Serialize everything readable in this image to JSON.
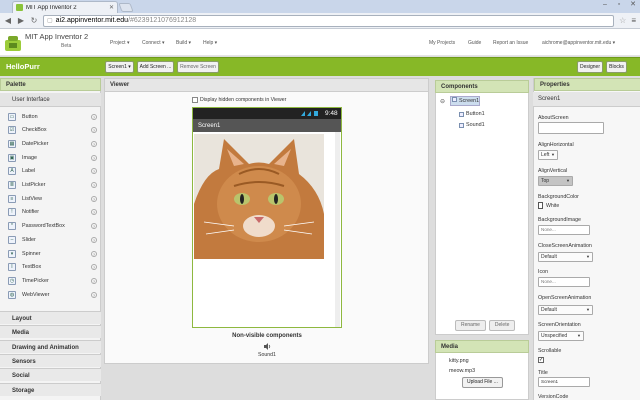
{
  "browser": {
    "tab_title": "MIT App Inventor 2",
    "url_host": "ai2.appinventor.mit.edu",
    "url_path": "/#6239121076912128",
    "colors": {
      "tabbar": "#c9d6ea"
    }
  },
  "header": {
    "brand": "MIT App Inventor 2",
    "beta": "Beta",
    "nav_left": [
      "Project ▾",
      "Connect ▾",
      "Build ▾",
      "Help ▾"
    ],
    "nav_right": [
      "My Projects",
      "Guide",
      "Report an Issue",
      "aichrome@appinventor.mit.edu ▾"
    ]
  },
  "projectbar": {
    "name": "HelloPurr",
    "screen_select": "Screen1 ▾",
    "add_screen": "Add Screen ...",
    "remove_screen": "Remove Screen",
    "designer": "Designer",
    "blocks": "Blocks",
    "accent": "#87b827"
  },
  "palette": {
    "title": "Palette",
    "section": "User Interface",
    "items": [
      {
        "label": "Button",
        "icon": "button-icon"
      },
      {
        "label": "CheckBox",
        "icon": "checkbox-icon"
      },
      {
        "label": "DatePicker",
        "icon": "datepicker-icon"
      },
      {
        "label": "Image",
        "icon": "image-icon"
      },
      {
        "label": "Label",
        "icon": "label-icon"
      },
      {
        "label": "ListPicker",
        "icon": "listpicker-icon"
      },
      {
        "label": "ListView",
        "icon": "listview-icon"
      },
      {
        "label": "Notifier",
        "icon": "notifier-icon"
      },
      {
        "label": "PasswordTextBox",
        "icon": "password-icon"
      },
      {
        "label": "Slider",
        "icon": "slider-icon"
      },
      {
        "label": "Spinner",
        "icon": "spinner-icon"
      },
      {
        "label": "TextBox",
        "icon": "textbox-icon"
      },
      {
        "label": "TimePicker",
        "icon": "timepicker-icon"
      },
      {
        "label": "WebViewer",
        "icon": "webviewer-icon"
      }
    ],
    "categories": [
      "Layout",
      "Media",
      "Drawing and Animation",
      "Sensors",
      "Social",
      "Storage"
    ]
  },
  "viewer": {
    "title": "Viewer",
    "hidden_checkbox": "Display hidden components in Viewer",
    "time": "9:48",
    "screen_title": "Screen1",
    "nonvisible_label": "Non-visible components",
    "nonvisible_item": "Sound1"
  },
  "components": {
    "title": "Components",
    "tree_root": "Screen1",
    "children": [
      "Button1",
      "Sound1"
    ],
    "rename": "Rename",
    "delete": "Delete"
  },
  "media": {
    "title": "Media",
    "files": [
      "kitty.png",
      "meow.mp3"
    ],
    "upload": "Upload File ..."
  },
  "properties": {
    "title": "Properties",
    "component": "Screen1",
    "about_label": "AboutScreen",
    "alignh_label": "AlignHorizontal",
    "alignh_value": "Left",
    "alignv_label": "AlignVertical",
    "alignv_value": "Top",
    "bgcolor_label": "BackgroundColor",
    "bgcolor_value": "White",
    "bgimage_label": "BackgroundImage",
    "bgimage_value": "None...",
    "closeanim_label": "CloseScreenAnimation",
    "closeanim_value": "Default",
    "icon_label": "Icon",
    "icon_value": "None...",
    "openanim_label": "OpenScreenAnimation",
    "openanim_value": "Default",
    "orient_label": "ScreenOrientation",
    "orient_value": "Unspecified",
    "scroll_label": "Scrollable",
    "title_label": "Title",
    "title_value": "Screen1",
    "version_label": "VersionCode"
  }
}
